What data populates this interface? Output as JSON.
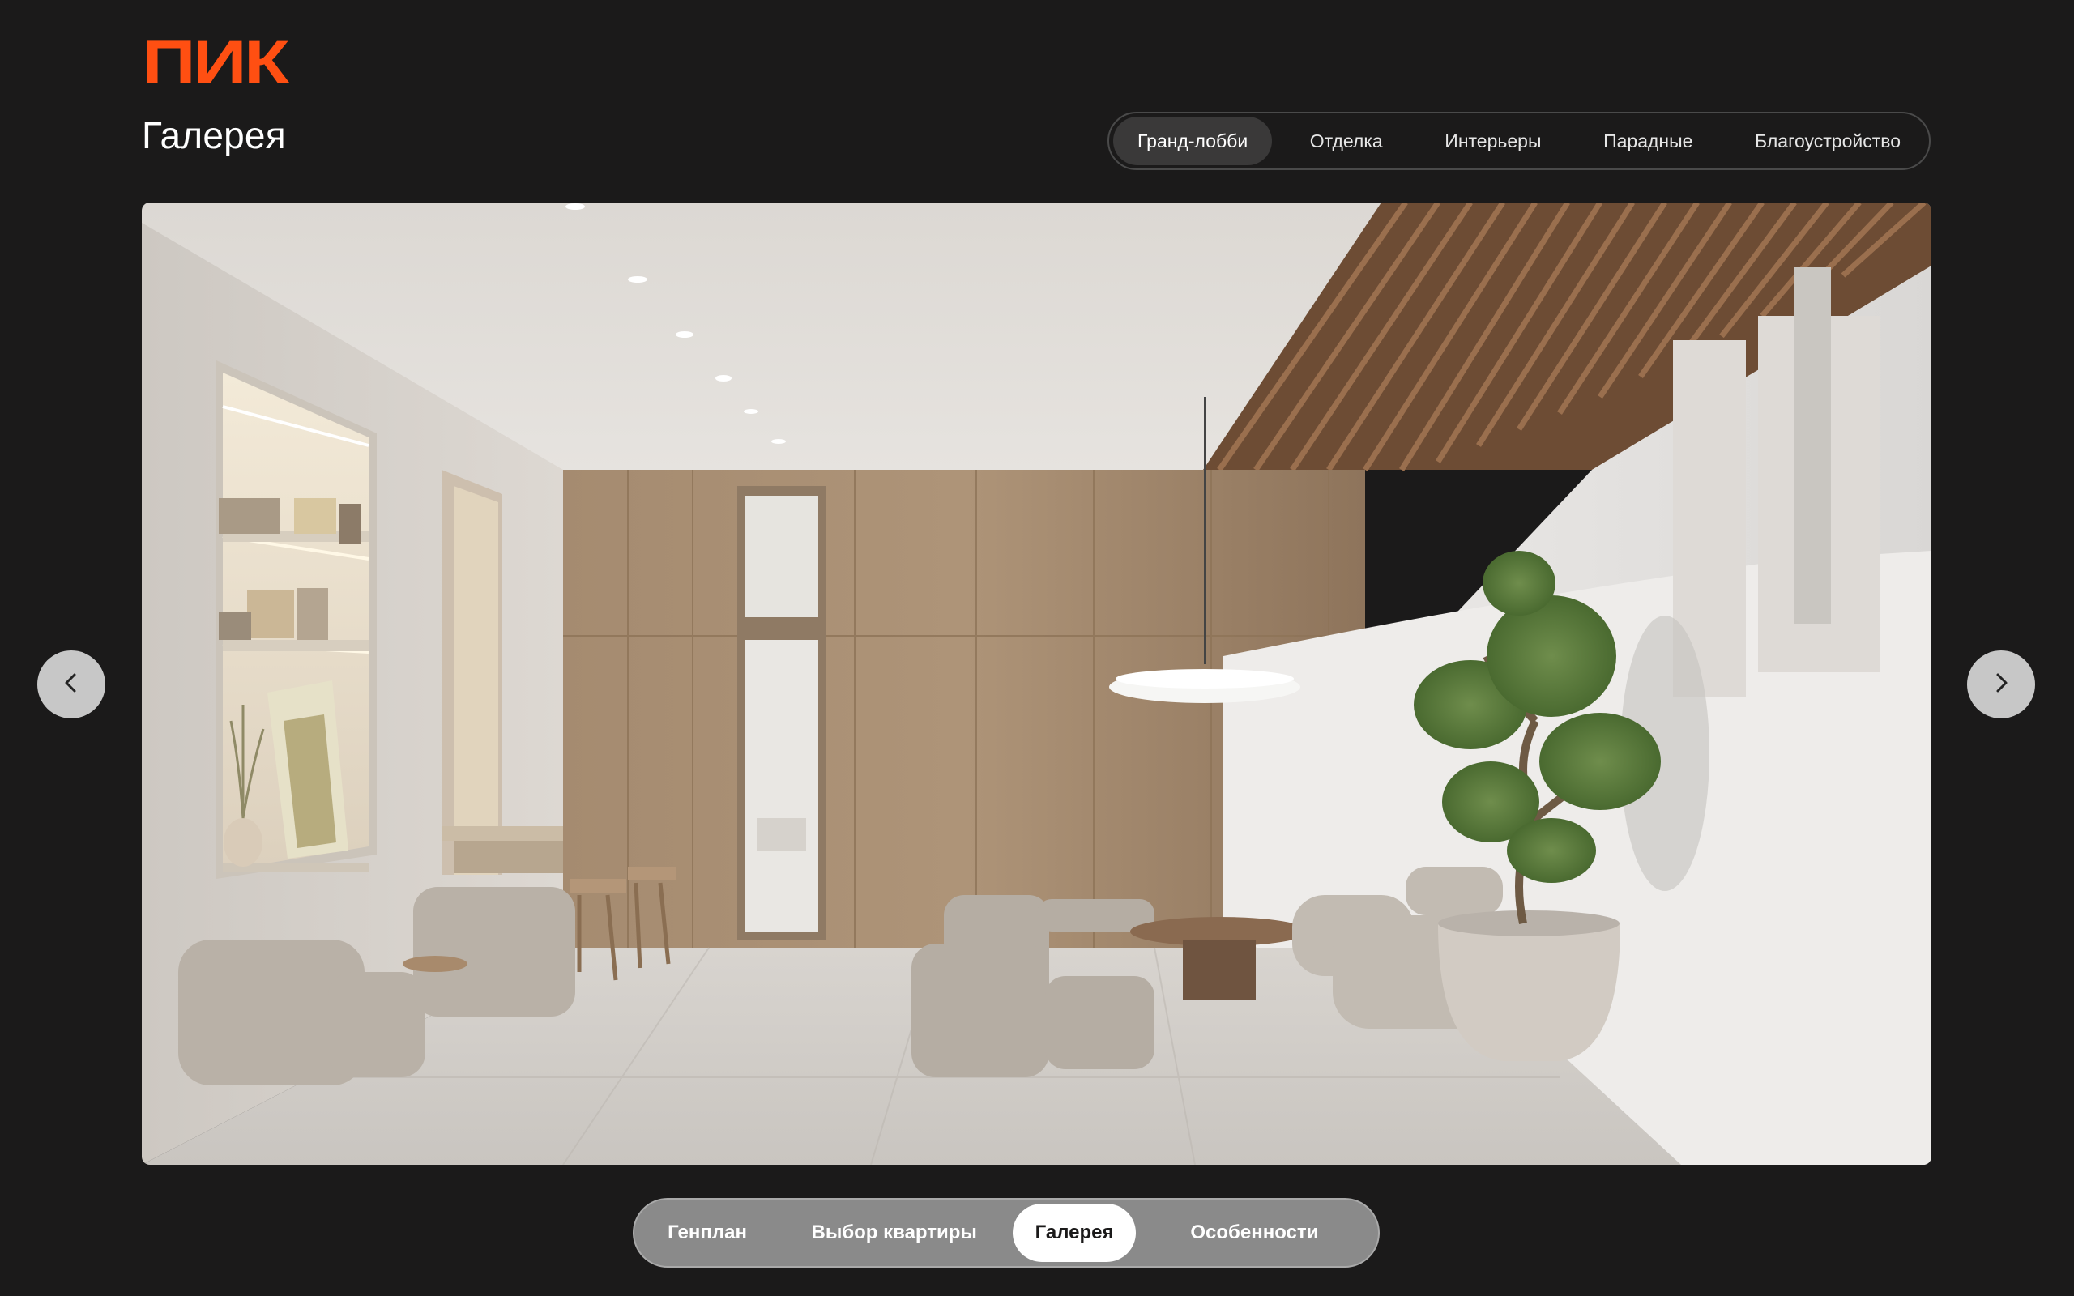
{
  "brand": {
    "logo_text": "ПИК",
    "accent": "#ff4f12"
  },
  "page": {
    "title": "Галерея",
    "background": "#1b1a1a"
  },
  "category_tabs": [
    {
      "label": "Гранд-лобби",
      "active": true
    },
    {
      "label": "Отделка",
      "active": false
    },
    {
      "label": "Интерьеры",
      "active": false
    },
    {
      "label": "Парадные",
      "active": false
    },
    {
      "label": "Благоустройство",
      "active": false
    }
  ],
  "gallery": {
    "prev_icon": "chevron-left-icon",
    "next_icon": "chevron-right-icon"
  },
  "bottom_nav": [
    {
      "label": "Генплан",
      "active": false
    },
    {
      "label": "Выбор квартиры",
      "active": false
    },
    {
      "label": "Галерея",
      "active": true
    },
    {
      "label": "Особенности",
      "active": false
    }
  ]
}
